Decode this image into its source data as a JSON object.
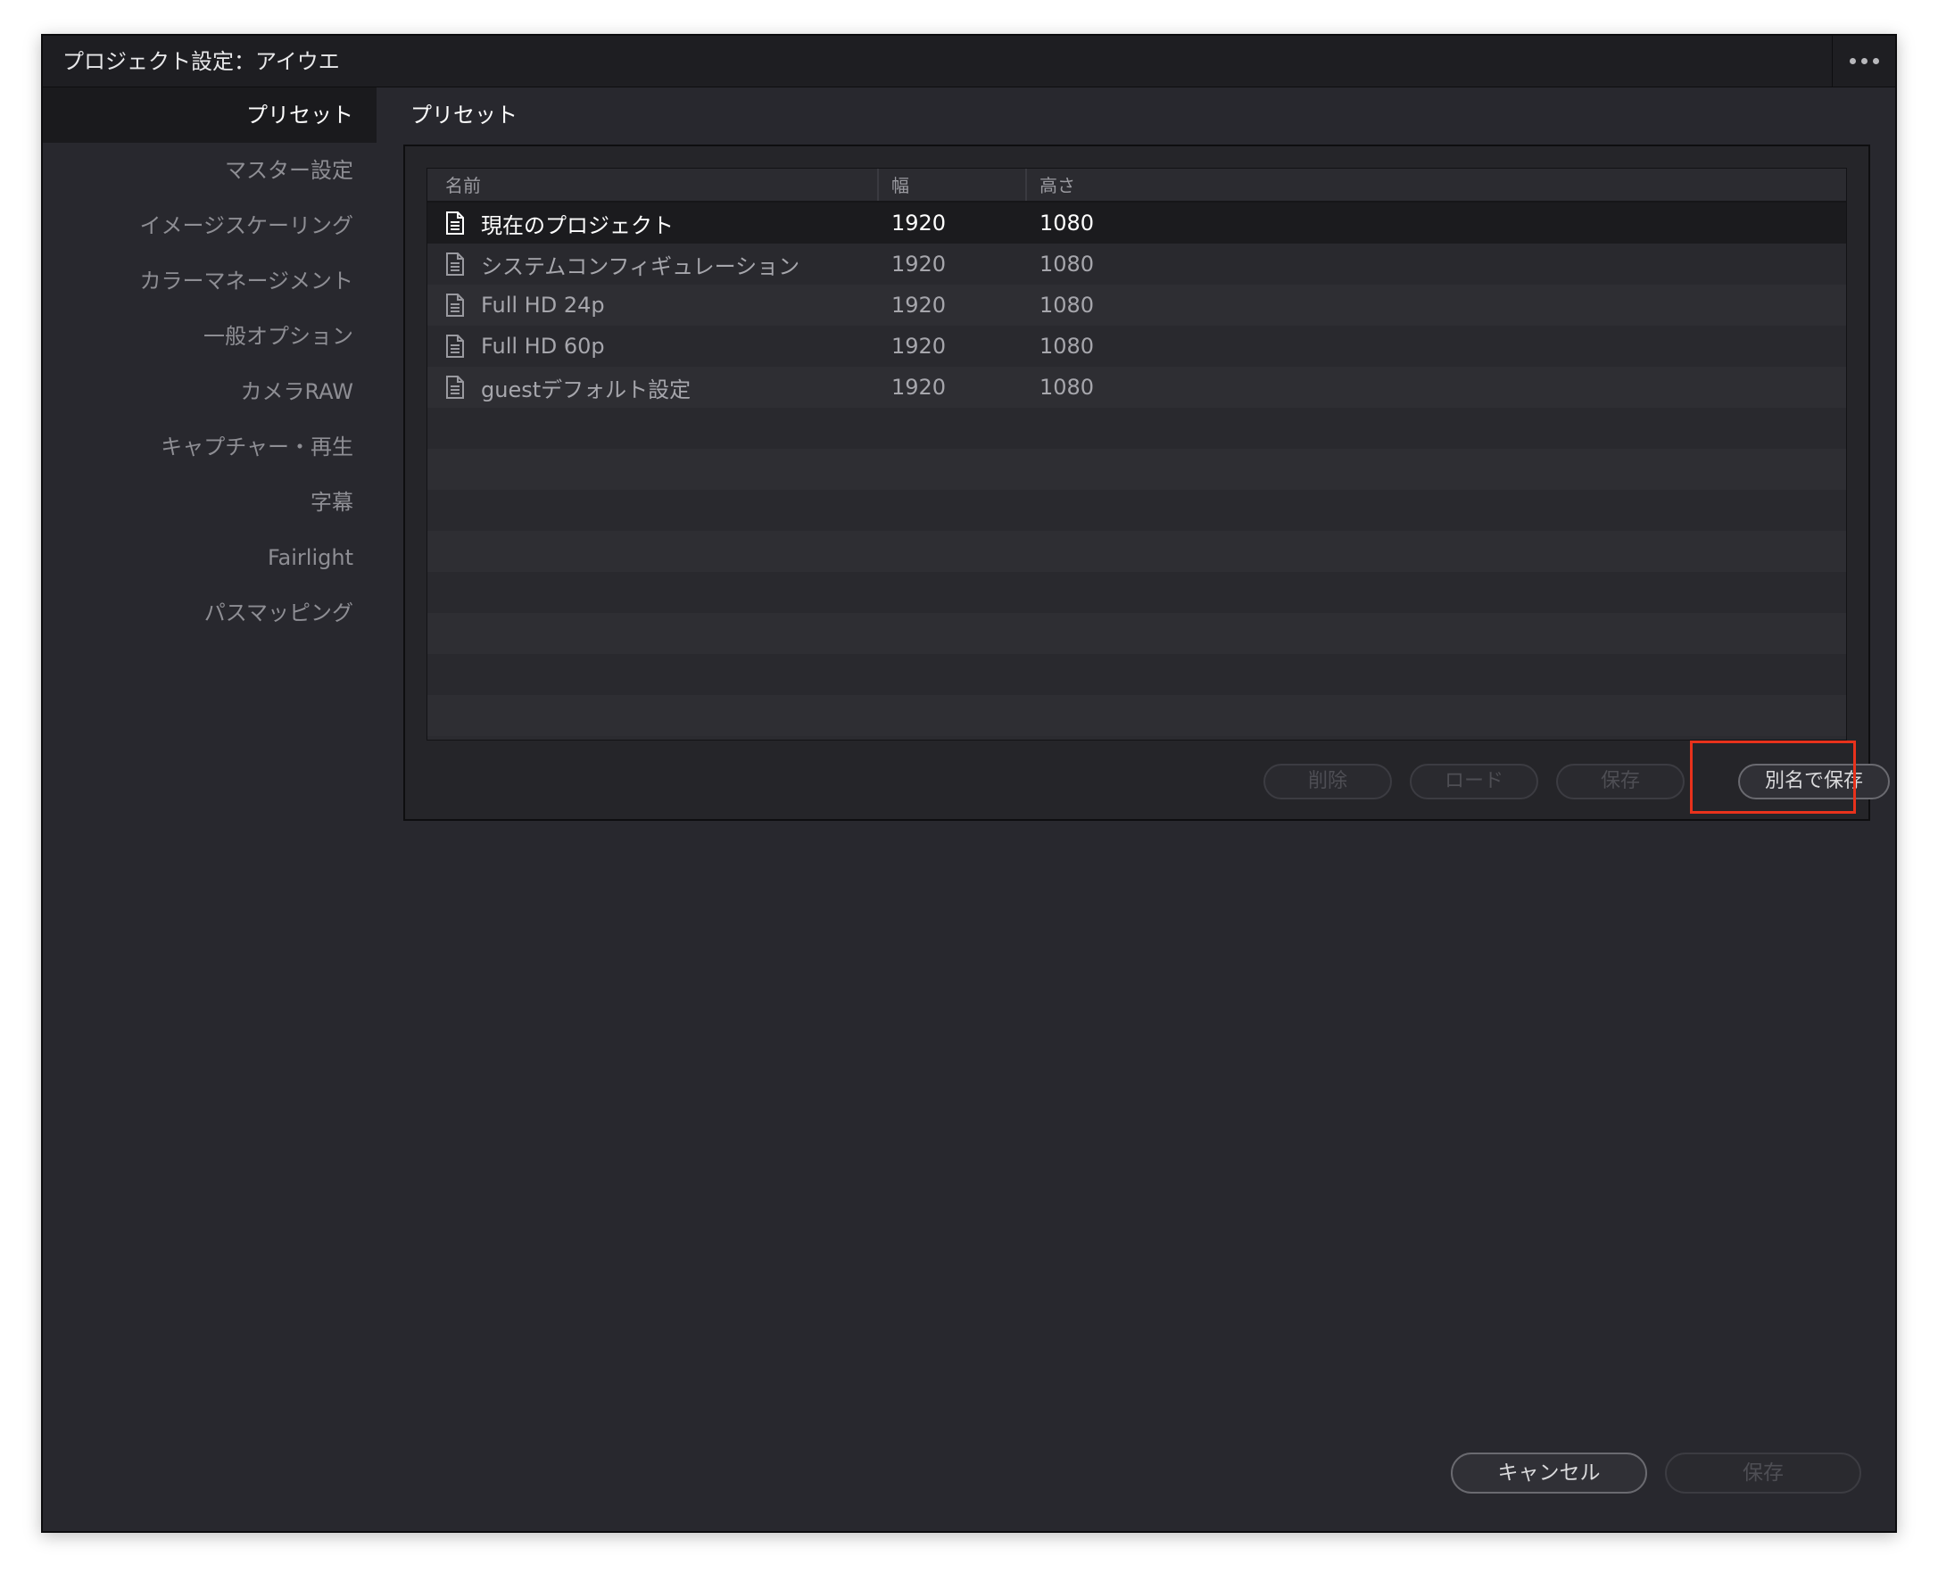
{
  "window": {
    "title": "プロジェクト設定：アイウエ",
    "menu_icon": "ellipsis-icon"
  },
  "sidebar": {
    "items": [
      {
        "label": "プリセット",
        "active": true
      },
      {
        "label": "マスター設定"
      },
      {
        "label": "イメージスケーリング"
      },
      {
        "label": "カラーマネージメント"
      },
      {
        "label": "一般オプション"
      },
      {
        "label": "カメラRAW"
      },
      {
        "label": "キャプチャー・再生"
      },
      {
        "label": "字幕"
      },
      {
        "label": "Fairlight"
      },
      {
        "label": "パスマッピング"
      }
    ]
  },
  "main": {
    "section_title": "プリセット",
    "table": {
      "columns": [
        "名前",
        "幅",
        "高さ"
      ],
      "rows": [
        {
          "name": "現在のプロジェクト",
          "width": "1920",
          "height": "1080",
          "selected": true,
          "icon": "document-icon"
        },
        {
          "name": "システムコンフィギュレーション",
          "width": "1920",
          "height": "1080",
          "icon": "document-icon"
        },
        {
          "name": "Full HD 24p",
          "width": "1920",
          "height": "1080",
          "icon": "document-icon"
        },
        {
          "name": "Full HD 60p",
          "width": "1920",
          "height": "1080",
          "icon": "document-icon"
        },
        {
          "name": "guestデフォルト設定",
          "width": "1920",
          "height": "1080",
          "icon": "document-icon"
        }
      ]
    },
    "buttons": {
      "delete": "削除",
      "load": "ロード",
      "save": "保存",
      "save_as": "別名で保存"
    }
  },
  "footer": {
    "cancel": "キャンセル",
    "save": "保存"
  },
  "colors": {
    "background": "#28282e",
    "highlight": "#e8321c"
  }
}
